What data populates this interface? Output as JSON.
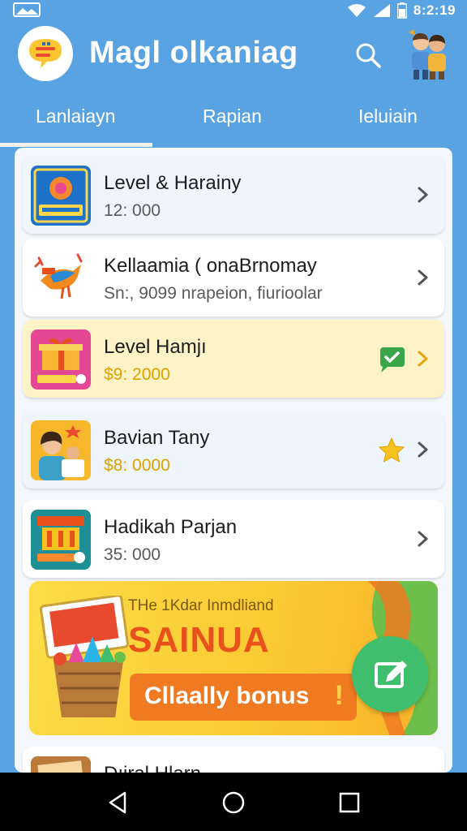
{
  "status_bar": {
    "time": "8:2:19",
    "icons": [
      "photo-icon",
      "wifi-icon",
      "signal-icon",
      "battery-icon"
    ]
  },
  "app_bar": {
    "title": "Magl olkaniag",
    "logo_icon": "chat-logo-icon",
    "search_icon": "search-icon",
    "avatar_icon": "family-avatar-icon"
  },
  "tabs": [
    {
      "label": "Lanlaiayn",
      "selected": true
    },
    {
      "label": "Rapian",
      "selected": false
    },
    {
      "label": "Ieluiain",
      "selected": false
    }
  ],
  "list": [
    {
      "title": "Level & Harainy",
      "subtitle": "12: 000",
      "thumb_icon": "game-thumb-icon",
      "badge": null
    },
    {
      "title": "Kellaamia ( onaBrnomay",
      "subtitle": "Sn:, 9099 nrapeion, fiurioolar",
      "thumb_icon": "bird-thumb-icon",
      "badge": null
    },
    {
      "title": "Level Hamjı",
      "subtitle": "$9: 2000",
      "thumb_icon": "gift-thumb-icon",
      "badge": "chat-check-icon"
    },
    {
      "title": "Bavian Tany",
      "subtitle": "$8: 0000",
      "thumb_icon": "family-thumb-icon",
      "badge": "star-icon"
    },
    {
      "title": "Hadikah Parjan",
      "subtitle": "35: 000",
      "thumb_icon": "shop-thumb-icon",
      "badge": null
    },
    {
      "title": "Dıiral Hlarn",
      "subtitle": "",
      "thumb_icon": "item-thumb-icon",
      "badge": null
    }
  ],
  "banner": {
    "kicker": "THe 1Kdar Inmdliand",
    "headline": "SAINUA",
    "cta_label": "Cllaally bonus",
    "cta_bang": "!"
  },
  "fab_icon": "edit-icon",
  "nav": [
    "back-icon",
    "home-icon",
    "recents-icon"
  ],
  "colors": {
    "primary": "#5aa3e2",
    "accent_green": "#3fbf6e",
    "accent_orange": "#f07a22",
    "gold_text": "#e0a100"
  }
}
